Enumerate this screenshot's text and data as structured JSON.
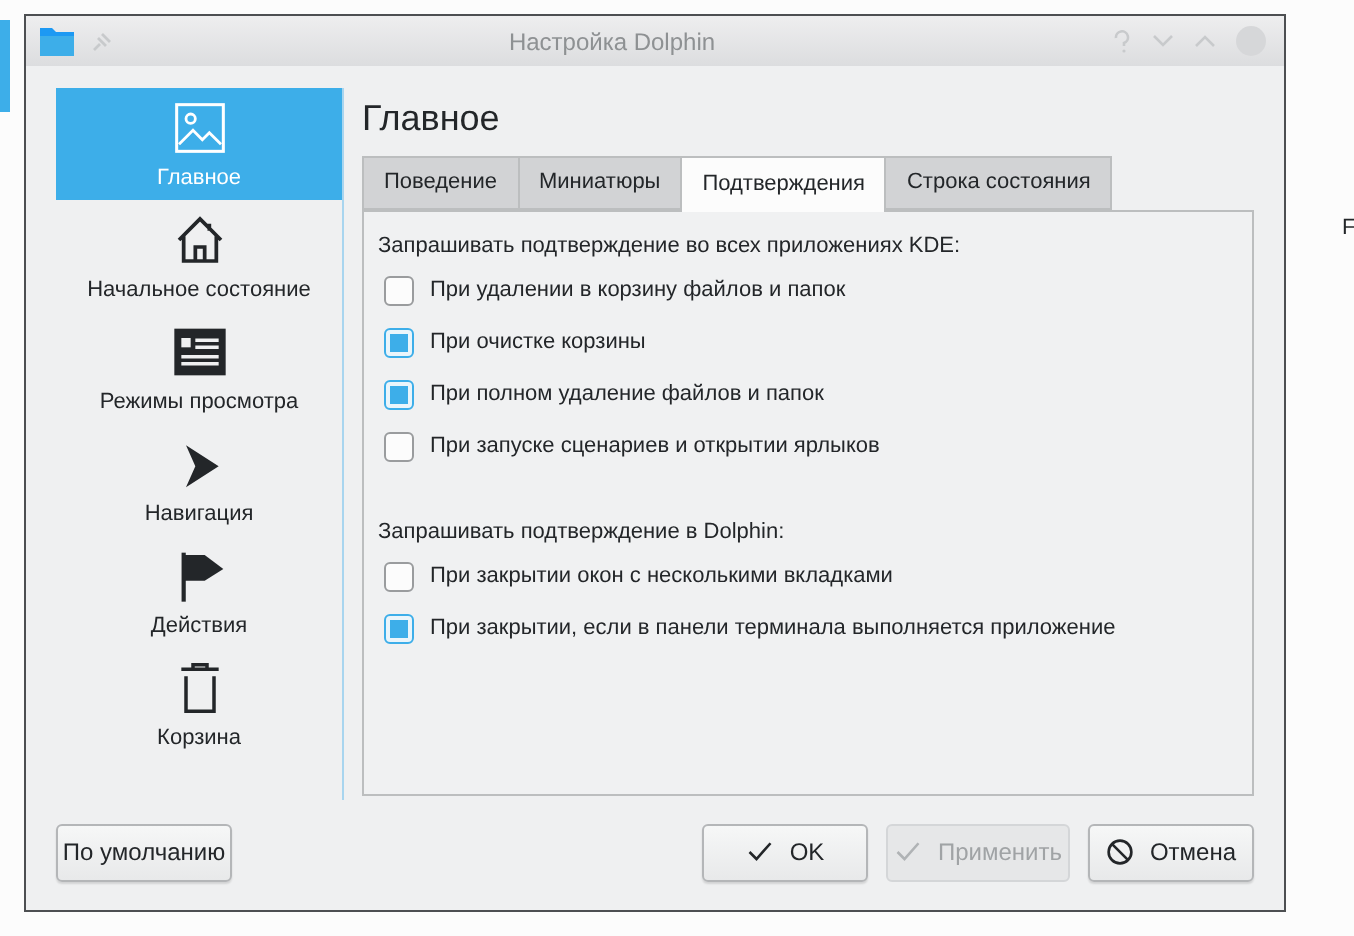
{
  "window": {
    "title": "Настройка Dolphin"
  },
  "sidebar": {
    "items": [
      {
        "label": "Главное",
        "selected": true
      },
      {
        "label": "Начальное состояние",
        "selected": false
      },
      {
        "label": "Режимы просмотра",
        "selected": false
      },
      {
        "label": "Навигация",
        "selected": false
      },
      {
        "label": "Действия",
        "selected": false
      },
      {
        "label": "Корзина",
        "selected": false
      }
    ]
  },
  "page_title": "Главное",
  "tabs": [
    {
      "label": "Поведение",
      "selected": false
    },
    {
      "label": "Миниатюры",
      "selected": false
    },
    {
      "label": "Подтверждения",
      "selected": true
    },
    {
      "label": "Строка состояния",
      "selected": false
    }
  ],
  "sections": [
    {
      "heading": "Запрашивать подтверждение во всех приложениях KDE:",
      "options": [
        {
          "label": "При удалении в корзину файлов и папок",
          "checked": false
        },
        {
          "label": "При очистке корзины",
          "checked": true
        },
        {
          "label": "При полном удаление файлов и папок",
          "checked": true
        },
        {
          "label": "При запуске сценариев и открытии ярлыков",
          "checked": false
        }
      ]
    },
    {
      "heading": "Запрашивать подтверждение в Dolphin:",
      "options": [
        {
          "label": "При закрытии окон с несколькими вкладками",
          "checked": false
        },
        {
          "label": "При закрытии, если в панели терминала выполняется приложение",
          "checked": true
        }
      ]
    }
  ],
  "buttons": [
    {
      "label": "По умолчанию",
      "kind": "plain",
      "disabled": false
    },
    {
      "label": "OK",
      "kind": "ok",
      "disabled": false
    },
    {
      "label": "Применить",
      "kind": "ok",
      "disabled": true
    },
    {
      "label": "Отмена",
      "kind": "cancel",
      "disabled": false
    }
  ],
  "edge_text": "F"
}
